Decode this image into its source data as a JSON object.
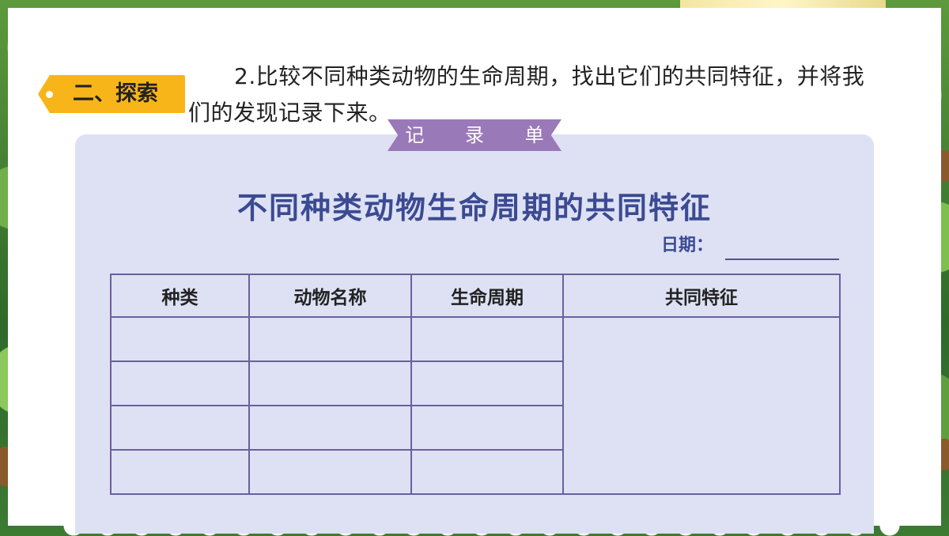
{
  "section_tag": "二、探索",
  "instruction": "2.比较不同种类动物的生命周期，找出它们的共同特征，并将我们的发现记录下来。",
  "record_card": {
    "ribbon_label": "记 录 单",
    "title": "不同种类动物生命周期的共同特征",
    "date_label": "日期：",
    "table": {
      "headers": [
        "种类",
        "动物名称",
        "生命周期",
        "共同特征"
      ],
      "rows": 4
    }
  },
  "colors": {
    "tag": "#f8b51a",
    "card": "#dde1f3",
    "ribbon": "#9a79b8",
    "title": "#3b4a92",
    "table_border": "#6a5fa0"
  }
}
